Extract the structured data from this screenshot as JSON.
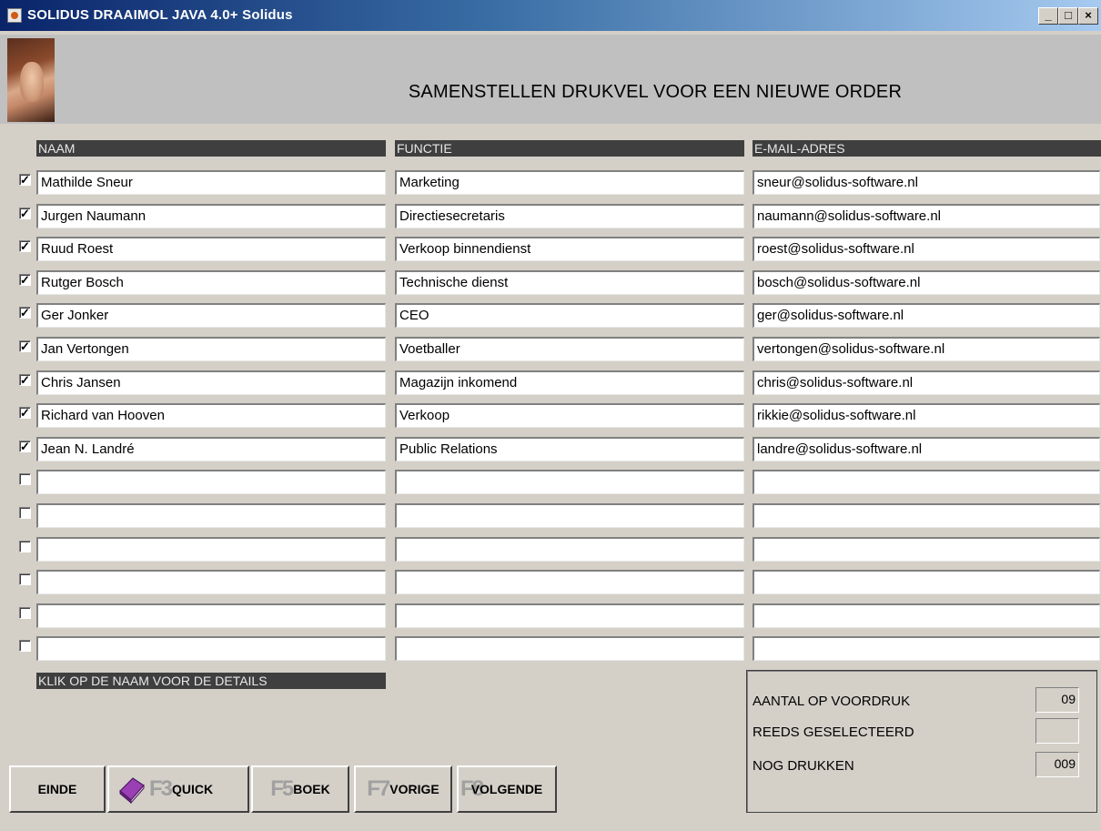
{
  "window": {
    "title": "SOLIDUS DRAAIMOL JAVA 4.0+ Solidus",
    "controls": [
      "_",
      "□",
      "×"
    ]
  },
  "header": {
    "page_title": "SAMENSTELLEN DRUKVEL VOOR EEN NIEUWE ORDER"
  },
  "columns": {
    "name": "NAAM",
    "function": "FUNCTIE",
    "email": "E-MAIL-ADRES"
  },
  "rows": [
    {
      "checked": true,
      "name": "Mathilde Sneur",
      "function": "Marketing",
      "email": "sneur@solidus-software.nl"
    },
    {
      "checked": true,
      "name": "Jurgen Naumann",
      "function": "Directiesecretaris",
      "email": "naumann@solidus-software.nl"
    },
    {
      "checked": true,
      "name": "Ruud Roest",
      "function": "Verkoop binnendienst",
      "email": "roest@solidus-software.nl"
    },
    {
      "checked": true,
      "name": "Rutger Bosch",
      "function": "Technische dienst",
      "email": "bosch@solidus-software.nl"
    },
    {
      "checked": true,
      "name": "Ger Jonker",
      "function": "CEO",
      "email": "ger@solidus-software.nl"
    },
    {
      "checked": true,
      "name": "Jan Vertongen",
      "function": "Voetballer",
      "email": "vertongen@solidus-software.nl"
    },
    {
      "checked": true,
      "name": "Chris Jansen",
      "function": "Magazijn inkomend",
      "email": "chris@solidus-software.nl"
    },
    {
      "checked": true,
      "name": "Richard van Hooven",
      "function": "Verkoop",
      "email": "rikkie@solidus-software.nl"
    },
    {
      "checked": true,
      "name": "Jean N. Landré",
      "function": "Public Relations",
      "email": "landre@solidus-software.nl"
    },
    {
      "checked": false,
      "name": "",
      "function": "",
      "email": ""
    },
    {
      "checked": false,
      "name": "",
      "function": "",
      "email": ""
    },
    {
      "checked": false,
      "name": "",
      "function": "",
      "email": ""
    },
    {
      "checked": false,
      "name": "",
      "function": "",
      "email": ""
    },
    {
      "checked": false,
      "name": "",
      "function": "",
      "email": ""
    },
    {
      "checked": false,
      "name": "",
      "function": "",
      "email": ""
    }
  ],
  "hint": "KLIK OP DE NAAM VOOR DE DETAILS",
  "buttons": {
    "exit": "EINDE",
    "quick_key": "F3",
    "quick": "QUICK",
    "book_key": "F5",
    "book": "BOEK",
    "prev_key": "F7",
    "prev": "VORIGE",
    "next_key": "F8",
    "next": "VOLGENDE"
  },
  "stats": {
    "count_label": "AANTAL OP VOORDRUK",
    "count_value": "09",
    "selected_label": "REEDS GESELECTEERD",
    "selected_value": "",
    "remaining_label": "NOG DRUKKEN",
    "remaining_value": "009"
  },
  "icons": {
    "app": "java-cup-icon",
    "book": "book-icon"
  },
  "colors": {
    "title_bar_start": "#0a246a",
    "title_bar_end": "#a6caf0",
    "header_bg": "#3f3f3f",
    "book": "#9b3fb5"
  }
}
